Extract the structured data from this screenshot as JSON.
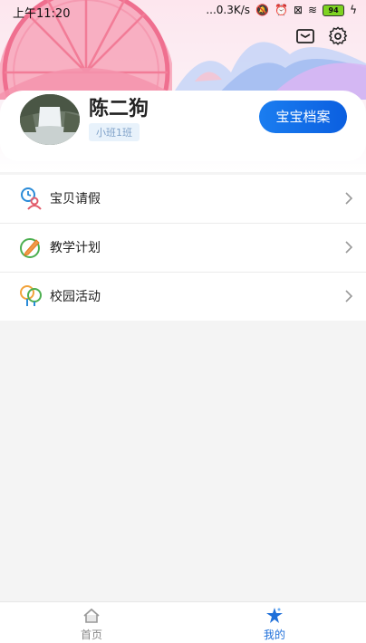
{
  "status_bar": {
    "time": "上午11:20",
    "network_speed": "...0.3K/s",
    "battery": "94"
  },
  "profile": {
    "name": "陈二狗",
    "class_name": "小班1班",
    "archive_button": "宝宝档案"
  },
  "menu": [
    {
      "label": "宝贝请假",
      "icon": "leave-request-icon"
    },
    {
      "label": "教学计划",
      "icon": "teaching-plan-icon"
    },
    {
      "label": "校园活动",
      "icon": "campus-activity-icon"
    }
  ],
  "bottom_nav": {
    "home_label": "首页",
    "mine_label": "我的"
  },
  "colors": {
    "accent": "#1a7df0",
    "active_tab": "#1e6fd9",
    "inactive_tab": "#888888"
  }
}
